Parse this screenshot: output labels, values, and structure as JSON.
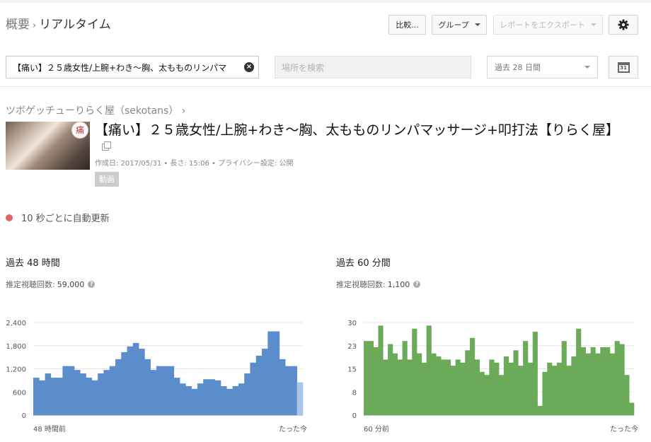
{
  "breadcrumb": {
    "parent": "概要",
    "separator": "›",
    "current": "リアルタイム"
  },
  "toolbar": {
    "compare": "比較...",
    "group": "グループ",
    "export": "レポートをエクスポート"
  },
  "search": {
    "video_value": "【痛い】２５歳女性/上腕+わき～胸、太もものリンパマ",
    "place_placeholder": "場所を検索"
  },
  "period": {
    "selected": "過去 28 日間"
  },
  "calendar": {
    "day": "31"
  },
  "channel": {
    "name": "ツボゲッチューりらく屋（sekotans）",
    "chevron": "›"
  },
  "video": {
    "thumb_badge": "痛",
    "title": "【痛い】２５歳女性/上腕+わき～胸、太もものリンパマッサージ+叩打法【りらく屋】",
    "created": "作成日: 2017/05/31",
    "dot": "•",
    "duration": "長さ: 15:06",
    "privacy": "プライバシー設定: 公開",
    "type": "動画"
  },
  "refresh": {
    "label": "10 秒ごとに自動更新",
    "dot_color": "#e06666"
  },
  "panels": {
    "p48": {
      "title": "過去 48 時間",
      "views_label": "推定視聴回数:",
      "views_value": "59,000",
      "help": "?"
    },
    "p60": {
      "title": "過去 60 分間",
      "views_label": "推定視聴回数:",
      "views_value": "1,100",
      "help": "?"
    }
  },
  "chart_data": [
    {
      "type": "bar",
      "title": "",
      "xlabel": "",
      "ylabel": "",
      "x_start_label": "48 時間前",
      "x_end_label": "たった今",
      "ylim": [
        0,
        2400
      ],
      "yticks": [
        "0",
        "600",
        "1,200",
        "1,800",
        "2,400"
      ],
      "ytick_values": [
        0,
        600,
        1200,
        1800,
        2400
      ],
      "color": "#5b8ccc",
      "current_color": "#a8c6ea",
      "values": [
        970,
        900,
        1080,
        970,
        970,
        1270,
        1270,
        1170,
        1080,
        970,
        900,
        1080,
        1170,
        1270,
        1450,
        1630,
        1780,
        1870,
        1720,
        1450,
        1170,
        1270,
        1270,
        1270,
        970,
        820,
        750,
        680,
        820,
        930,
        930,
        900,
        750,
        680,
        750,
        820,
        1080,
        1360,
        1540,
        1720,
        2170,
        2170,
        1450,
        1270,
        1270,
        850
      ],
      "grid": true
    },
    {
      "type": "bar",
      "title": "",
      "xlabel": "",
      "ylabel": "",
      "x_start_label": "60 分前",
      "x_end_label": "たった今",
      "ylim": [
        0,
        30
      ],
      "yticks": [
        "0",
        "8",
        "15",
        "23",
        "30"
      ],
      "ytick_values": [
        0,
        7.5,
        15,
        22.5,
        30
      ],
      "color": "#6aaa59",
      "values": [
        24,
        24,
        22,
        29,
        18,
        23,
        20,
        18,
        24,
        18,
        28,
        20,
        17,
        29,
        20,
        19,
        18,
        18,
        16,
        18,
        17,
        21,
        25,
        18,
        14,
        13,
        18,
        17,
        13,
        19,
        17,
        21,
        16,
        24,
        17,
        27,
        3,
        14,
        17,
        16,
        17,
        24,
        16,
        19,
        28,
        22,
        20,
        22,
        20,
        22,
        22,
        20,
        24,
        23,
        13,
        4
      ],
      "grid": true
    }
  ]
}
